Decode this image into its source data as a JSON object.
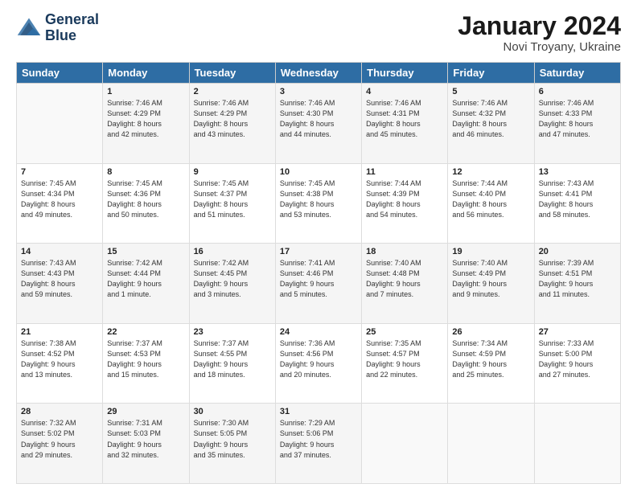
{
  "logo": {
    "line1": "General",
    "line2": "Blue"
  },
  "title": "January 2024",
  "location": "Novi Troyany, Ukraine",
  "days_header": [
    "Sunday",
    "Monday",
    "Tuesday",
    "Wednesday",
    "Thursday",
    "Friday",
    "Saturday"
  ],
  "weeks": [
    [
      {
        "num": "",
        "info": ""
      },
      {
        "num": "1",
        "info": "Sunrise: 7:46 AM\nSunset: 4:29 PM\nDaylight: 8 hours\nand 42 minutes."
      },
      {
        "num": "2",
        "info": "Sunrise: 7:46 AM\nSunset: 4:29 PM\nDaylight: 8 hours\nand 43 minutes."
      },
      {
        "num": "3",
        "info": "Sunrise: 7:46 AM\nSunset: 4:30 PM\nDaylight: 8 hours\nand 44 minutes."
      },
      {
        "num": "4",
        "info": "Sunrise: 7:46 AM\nSunset: 4:31 PM\nDaylight: 8 hours\nand 45 minutes."
      },
      {
        "num": "5",
        "info": "Sunrise: 7:46 AM\nSunset: 4:32 PM\nDaylight: 8 hours\nand 46 minutes."
      },
      {
        "num": "6",
        "info": "Sunrise: 7:46 AM\nSunset: 4:33 PM\nDaylight: 8 hours\nand 47 minutes."
      }
    ],
    [
      {
        "num": "7",
        "info": "Sunrise: 7:45 AM\nSunset: 4:34 PM\nDaylight: 8 hours\nand 49 minutes."
      },
      {
        "num": "8",
        "info": "Sunrise: 7:45 AM\nSunset: 4:36 PM\nDaylight: 8 hours\nand 50 minutes."
      },
      {
        "num": "9",
        "info": "Sunrise: 7:45 AM\nSunset: 4:37 PM\nDaylight: 8 hours\nand 51 minutes."
      },
      {
        "num": "10",
        "info": "Sunrise: 7:45 AM\nSunset: 4:38 PM\nDaylight: 8 hours\nand 53 minutes."
      },
      {
        "num": "11",
        "info": "Sunrise: 7:44 AM\nSunset: 4:39 PM\nDaylight: 8 hours\nand 54 minutes."
      },
      {
        "num": "12",
        "info": "Sunrise: 7:44 AM\nSunset: 4:40 PM\nDaylight: 8 hours\nand 56 minutes."
      },
      {
        "num": "13",
        "info": "Sunrise: 7:43 AM\nSunset: 4:41 PM\nDaylight: 8 hours\nand 58 minutes."
      }
    ],
    [
      {
        "num": "14",
        "info": "Sunrise: 7:43 AM\nSunset: 4:43 PM\nDaylight: 8 hours\nand 59 minutes."
      },
      {
        "num": "15",
        "info": "Sunrise: 7:42 AM\nSunset: 4:44 PM\nDaylight: 9 hours\nand 1 minute."
      },
      {
        "num": "16",
        "info": "Sunrise: 7:42 AM\nSunset: 4:45 PM\nDaylight: 9 hours\nand 3 minutes."
      },
      {
        "num": "17",
        "info": "Sunrise: 7:41 AM\nSunset: 4:46 PM\nDaylight: 9 hours\nand 5 minutes."
      },
      {
        "num": "18",
        "info": "Sunrise: 7:40 AM\nSunset: 4:48 PM\nDaylight: 9 hours\nand 7 minutes."
      },
      {
        "num": "19",
        "info": "Sunrise: 7:40 AM\nSunset: 4:49 PM\nDaylight: 9 hours\nand 9 minutes."
      },
      {
        "num": "20",
        "info": "Sunrise: 7:39 AM\nSunset: 4:51 PM\nDaylight: 9 hours\nand 11 minutes."
      }
    ],
    [
      {
        "num": "21",
        "info": "Sunrise: 7:38 AM\nSunset: 4:52 PM\nDaylight: 9 hours\nand 13 minutes."
      },
      {
        "num": "22",
        "info": "Sunrise: 7:37 AM\nSunset: 4:53 PM\nDaylight: 9 hours\nand 15 minutes."
      },
      {
        "num": "23",
        "info": "Sunrise: 7:37 AM\nSunset: 4:55 PM\nDaylight: 9 hours\nand 18 minutes."
      },
      {
        "num": "24",
        "info": "Sunrise: 7:36 AM\nSunset: 4:56 PM\nDaylight: 9 hours\nand 20 minutes."
      },
      {
        "num": "25",
        "info": "Sunrise: 7:35 AM\nSunset: 4:57 PM\nDaylight: 9 hours\nand 22 minutes."
      },
      {
        "num": "26",
        "info": "Sunrise: 7:34 AM\nSunset: 4:59 PM\nDaylight: 9 hours\nand 25 minutes."
      },
      {
        "num": "27",
        "info": "Sunrise: 7:33 AM\nSunset: 5:00 PM\nDaylight: 9 hours\nand 27 minutes."
      }
    ],
    [
      {
        "num": "28",
        "info": "Sunrise: 7:32 AM\nSunset: 5:02 PM\nDaylight: 9 hours\nand 29 minutes."
      },
      {
        "num": "29",
        "info": "Sunrise: 7:31 AM\nSunset: 5:03 PM\nDaylight: 9 hours\nand 32 minutes."
      },
      {
        "num": "30",
        "info": "Sunrise: 7:30 AM\nSunset: 5:05 PM\nDaylight: 9 hours\nand 35 minutes."
      },
      {
        "num": "31",
        "info": "Sunrise: 7:29 AM\nSunset: 5:06 PM\nDaylight: 9 hours\nand 37 minutes."
      },
      {
        "num": "",
        "info": ""
      },
      {
        "num": "",
        "info": ""
      },
      {
        "num": "",
        "info": ""
      }
    ]
  ]
}
